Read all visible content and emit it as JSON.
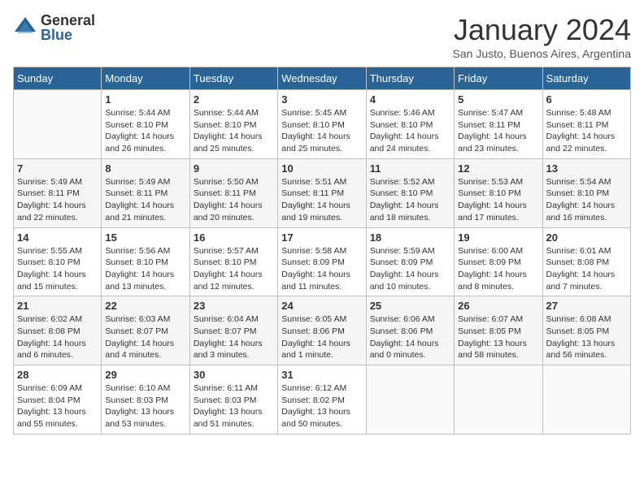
{
  "logo": {
    "general": "General",
    "blue": "Blue"
  },
  "title": "January 2024",
  "subtitle": "San Justo, Buenos Aires, Argentina",
  "weekdays": [
    "Sunday",
    "Monday",
    "Tuesday",
    "Wednesday",
    "Thursday",
    "Friday",
    "Saturday"
  ],
  "weeks": [
    [
      {
        "num": "",
        "info": ""
      },
      {
        "num": "1",
        "info": "Sunrise: 5:44 AM\nSunset: 8:10 PM\nDaylight: 14 hours\nand 26 minutes."
      },
      {
        "num": "2",
        "info": "Sunrise: 5:44 AM\nSunset: 8:10 PM\nDaylight: 14 hours\nand 25 minutes."
      },
      {
        "num": "3",
        "info": "Sunrise: 5:45 AM\nSunset: 8:10 PM\nDaylight: 14 hours\nand 25 minutes."
      },
      {
        "num": "4",
        "info": "Sunrise: 5:46 AM\nSunset: 8:10 PM\nDaylight: 14 hours\nand 24 minutes."
      },
      {
        "num": "5",
        "info": "Sunrise: 5:47 AM\nSunset: 8:11 PM\nDaylight: 14 hours\nand 23 minutes."
      },
      {
        "num": "6",
        "info": "Sunrise: 5:48 AM\nSunset: 8:11 PM\nDaylight: 14 hours\nand 22 minutes."
      }
    ],
    [
      {
        "num": "7",
        "info": "Sunrise: 5:49 AM\nSunset: 8:11 PM\nDaylight: 14 hours\nand 22 minutes."
      },
      {
        "num": "8",
        "info": "Sunrise: 5:49 AM\nSunset: 8:11 PM\nDaylight: 14 hours\nand 21 minutes."
      },
      {
        "num": "9",
        "info": "Sunrise: 5:50 AM\nSunset: 8:11 PM\nDaylight: 14 hours\nand 20 minutes."
      },
      {
        "num": "10",
        "info": "Sunrise: 5:51 AM\nSunset: 8:11 PM\nDaylight: 14 hours\nand 19 minutes."
      },
      {
        "num": "11",
        "info": "Sunrise: 5:52 AM\nSunset: 8:10 PM\nDaylight: 14 hours\nand 18 minutes."
      },
      {
        "num": "12",
        "info": "Sunrise: 5:53 AM\nSunset: 8:10 PM\nDaylight: 14 hours\nand 17 minutes."
      },
      {
        "num": "13",
        "info": "Sunrise: 5:54 AM\nSunset: 8:10 PM\nDaylight: 14 hours\nand 16 minutes."
      }
    ],
    [
      {
        "num": "14",
        "info": "Sunrise: 5:55 AM\nSunset: 8:10 PM\nDaylight: 14 hours\nand 15 minutes."
      },
      {
        "num": "15",
        "info": "Sunrise: 5:56 AM\nSunset: 8:10 PM\nDaylight: 14 hours\nand 13 minutes."
      },
      {
        "num": "16",
        "info": "Sunrise: 5:57 AM\nSunset: 8:10 PM\nDaylight: 14 hours\nand 12 minutes."
      },
      {
        "num": "17",
        "info": "Sunrise: 5:58 AM\nSunset: 8:09 PM\nDaylight: 14 hours\nand 11 minutes."
      },
      {
        "num": "18",
        "info": "Sunrise: 5:59 AM\nSunset: 8:09 PM\nDaylight: 14 hours\nand 10 minutes."
      },
      {
        "num": "19",
        "info": "Sunrise: 6:00 AM\nSunset: 8:09 PM\nDaylight: 14 hours\nand 8 minutes."
      },
      {
        "num": "20",
        "info": "Sunrise: 6:01 AM\nSunset: 8:08 PM\nDaylight: 14 hours\nand 7 minutes."
      }
    ],
    [
      {
        "num": "21",
        "info": "Sunrise: 6:02 AM\nSunset: 8:08 PM\nDaylight: 14 hours\nand 6 minutes."
      },
      {
        "num": "22",
        "info": "Sunrise: 6:03 AM\nSunset: 8:07 PM\nDaylight: 14 hours\nand 4 minutes."
      },
      {
        "num": "23",
        "info": "Sunrise: 6:04 AM\nSunset: 8:07 PM\nDaylight: 14 hours\nand 3 minutes."
      },
      {
        "num": "24",
        "info": "Sunrise: 6:05 AM\nSunset: 8:06 PM\nDaylight: 14 hours\nand 1 minute."
      },
      {
        "num": "25",
        "info": "Sunrise: 6:06 AM\nSunset: 8:06 PM\nDaylight: 14 hours\nand 0 minutes."
      },
      {
        "num": "26",
        "info": "Sunrise: 6:07 AM\nSunset: 8:05 PM\nDaylight: 13 hours\nand 58 minutes."
      },
      {
        "num": "27",
        "info": "Sunrise: 6:08 AM\nSunset: 8:05 PM\nDaylight: 13 hours\nand 56 minutes."
      }
    ],
    [
      {
        "num": "28",
        "info": "Sunrise: 6:09 AM\nSunset: 8:04 PM\nDaylight: 13 hours\nand 55 minutes."
      },
      {
        "num": "29",
        "info": "Sunrise: 6:10 AM\nSunset: 8:03 PM\nDaylight: 13 hours\nand 53 minutes."
      },
      {
        "num": "30",
        "info": "Sunrise: 6:11 AM\nSunset: 8:03 PM\nDaylight: 13 hours\nand 51 minutes."
      },
      {
        "num": "31",
        "info": "Sunrise: 6:12 AM\nSunset: 8:02 PM\nDaylight: 13 hours\nand 50 minutes."
      },
      {
        "num": "",
        "info": ""
      },
      {
        "num": "",
        "info": ""
      },
      {
        "num": "",
        "info": ""
      }
    ]
  ]
}
